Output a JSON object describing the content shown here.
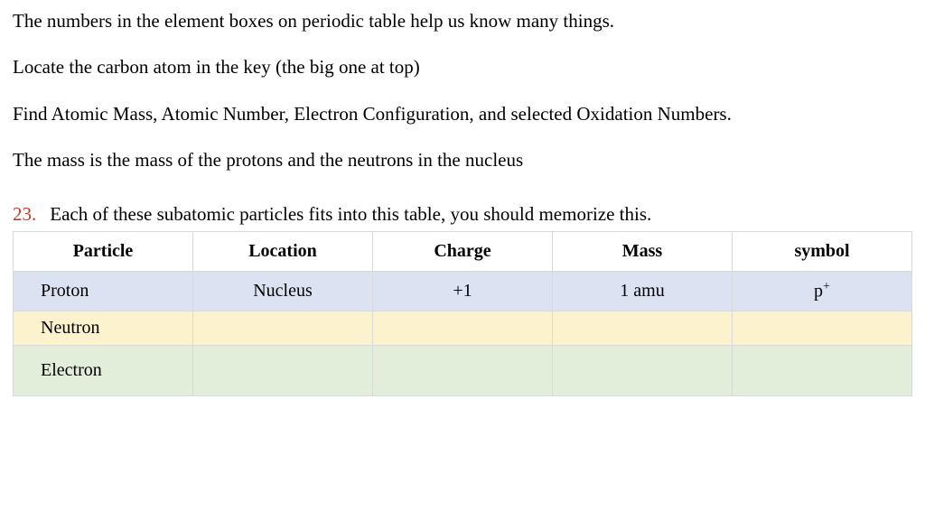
{
  "paragraphs": {
    "p1": "The numbers in the element boxes on periodic table help us know many things.",
    "p2": "Locate the carbon atom in the key (the big one at top)",
    "p3": "Find Atomic Mass, Atomic Number, Electron Configuration, and selected Oxidation Numbers.",
    "p4": "The mass is the mass of the protons and the neutrons in the nucleus"
  },
  "question": {
    "number": "23.",
    "text": "Each of these subatomic particles fits into this table, you should memorize this."
  },
  "table": {
    "headers": {
      "c0": "Particle",
      "c1": "Location",
      "c2": "Charge",
      "c3": "Mass",
      "c4": "symbol"
    },
    "rows": [
      {
        "particle": "Proton",
        "location": "Nucleus",
        "charge": "+1",
        "mass": "1 amu",
        "symbol_base": "p",
        "symbol_sup": "+"
      },
      {
        "particle": "Neutron",
        "location": "",
        "charge": "",
        "mass": "",
        "symbol_base": "",
        "symbol_sup": ""
      },
      {
        "particle": "Electron",
        "location": "",
        "charge": "",
        "mass": "",
        "symbol_base": "",
        "symbol_sup": ""
      }
    ]
  }
}
